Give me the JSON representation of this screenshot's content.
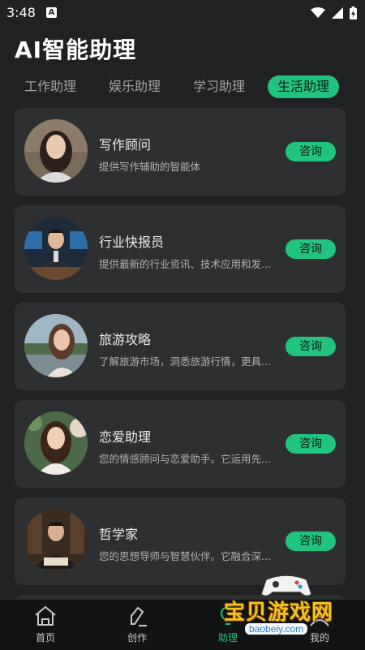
{
  "status_bar": {
    "time": "3:48",
    "notification_icon": "a-icon",
    "wifi_icon": "wifi-icon",
    "signal_icon": "signal-icon",
    "battery_icon": "battery-icon"
  },
  "app": {
    "title": "AI智能助理"
  },
  "tabs": [
    {
      "label": "工作助理",
      "active": false
    },
    {
      "label": "娱乐助理",
      "active": false
    },
    {
      "label": "学习助理",
      "active": false
    },
    {
      "label": "生活助理",
      "active": true
    }
  ],
  "cards": [
    {
      "name": "写作顾问",
      "desc": "提供写作辅助的智能体",
      "button": "咨询"
    },
    {
      "name": "行业快报员",
      "desc": "提供最新的行业资讯、技术应用和发...",
      "button": "咨询"
    },
    {
      "name": "旅游攻略",
      "desc": "了解旅游市场，洞悉旅游行情，更具...",
      "button": "咨询"
    },
    {
      "name": "恋爱助理",
      "desc": "您的情感顾问与恋爱助手。它运用先...",
      "button": "咨询"
    },
    {
      "name": "哲学家",
      "desc": "您的思想导师与智慧伙伴。它融合深...",
      "button": "咨询"
    }
  ],
  "bottom_nav": [
    {
      "label": "首页",
      "icon": "home-icon",
      "active": false
    },
    {
      "label": "创作",
      "icon": "edit-icon",
      "active": false
    },
    {
      "label": "助理",
      "icon": "bulb-icon",
      "active": true
    },
    {
      "label": "我的",
      "icon": "user-icon",
      "active": false
    }
  ],
  "watermark": {
    "text": "宝贝游戏网",
    "url": "baobeiy.com"
  },
  "colors": {
    "accent": "#21c47f",
    "background": "#1f2122",
    "card": "#2d2f30",
    "watermark": "#f5c21c"
  }
}
